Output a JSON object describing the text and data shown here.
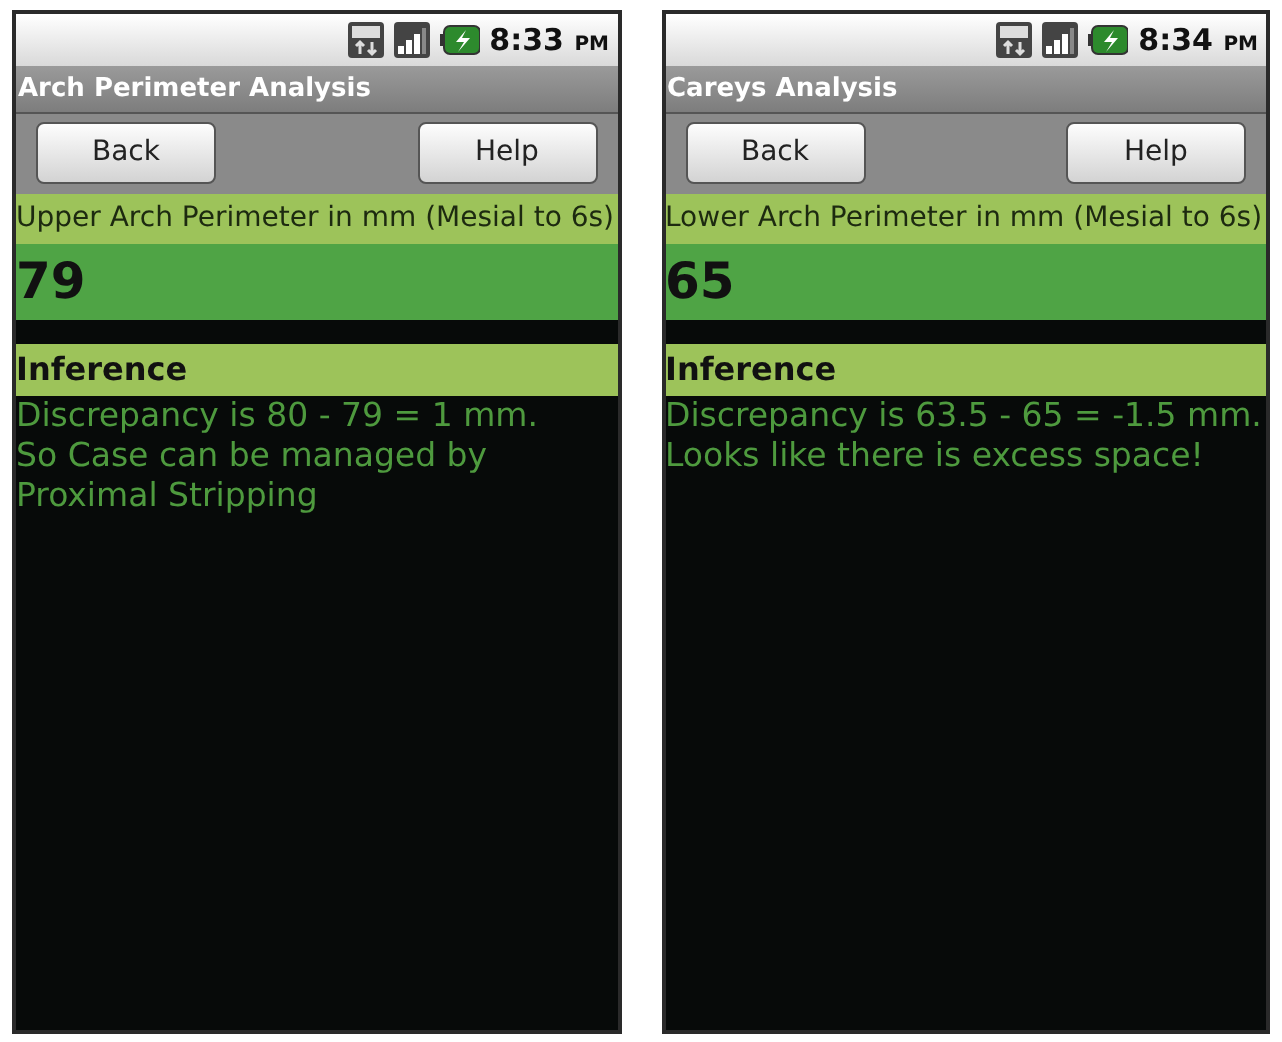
{
  "screens": [
    {
      "status": {
        "time": "8:33",
        "ampm": "PM"
      },
      "title": "Arch Perimeter Analysis",
      "buttons": [
        "Back",
        "Help"
      ],
      "field_label": "Upper Arch Perimeter in mm (Mesial to 6s)",
      "value": "79",
      "inference_heading": "Inference",
      "inference_text": [
        "Discrepancy is 80 - 79 = 1 mm.",
        "So Case can be managed by Proximal Stripping"
      ]
    },
    {
      "status": {
        "time": "8:34",
        "ampm": "PM"
      },
      "title": "Careys Analysis",
      "buttons": [
        "Back",
        "Help"
      ],
      "field_label": "Lower Arch Perimeter in mm (Mesial to 6s)",
      "value": "65",
      "inference_heading": "Inference",
      "inference_text": [
        "Discrepancy is 63.5 - 65 = -1.5 mm.",
        "Looks like there is excess space!"
      ]
    }
  ]
}
